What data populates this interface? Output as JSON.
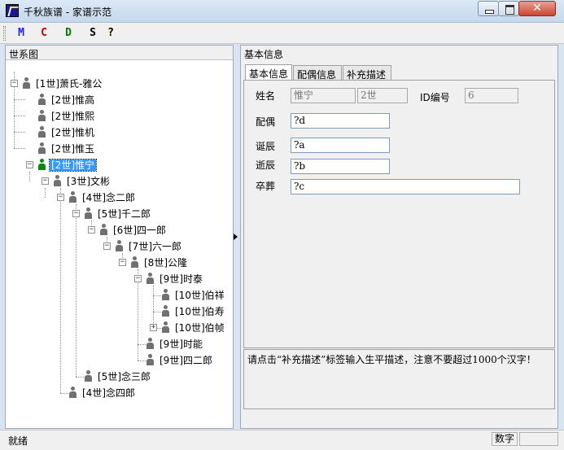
{
  "window": {
    "title": "千秋族谱 - 家谱示范"
  },
  "toolbar": {
    "buttons": [
      {
        "label": "M",
        "color": "#1a1aff"
      },
      {
        "label": "C",
        "color": "#c00000"
      },
      {
        "label": "D",
        "color": "#008000"
      },
      {
        "label": "S",
        "color": "#000000"
      },
      {
        "label": "?",
        "color": "#000000"
      }
    ]
  },
  "left_panel": {
    "title": "世系图",
    "tree": [
      "[1世]萧氏-雅公",
      "[2世]惟高",
      "[2世]惟熙",
      "[2世]惟机",
      "[2世]惟玉",
      "[2世]惟宁",
      "[3世]文彬",
      "[4世]念二郎",
      "[5世]千二郎",
      "[6世]四一郎",
      "[7世]六一郎",
      "[8世]公隆",
      "[9世]时泰",
      "[10世]伯祥",
      "[10世]伯寿",
      "[10世]伯帧",
      "[9世]时能",
      "[9世]四二郎",
      "[5世]念三郎",
      "[4世]念四郎"
    ]
  },
  "right_panel": {
    "title": "基本信息",
    "tabs": [
      "基本信息",
      "配偶信息",
      "补充描述"
    ],
    "labels": {
      "name": "姓名",
      "id": "ID编号",
      "spouse": "配偶",
      "birth": "诞辰",
      "death": "逝辰",
      "burial": "卒葬"
    },
    "values": {
      "name": "惟宁",
      "generation": "2世",
      "id": "6",
      "spouse": "?d",
      "birth": "?a",
      "death": "?b",
      "burial": "?c"
    },
    "description": "请点击“补充描述”标签输入生平描述，注意不要超过1000个汉字！"
  },
  "status": {
    "text": "就绪",
    "mode": "数字"
  }
}
